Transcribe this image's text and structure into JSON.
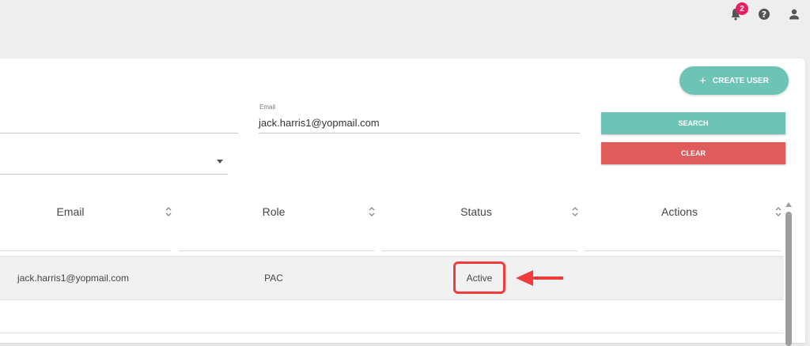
{
  "header": {
    "notification_count": "2",
    "icons": [
      "bell-icon",
      "help-icon",
      "user-icon"
    ]
  },
  "toolbar": {
    "create_user_label": "CREATE USER",
    "create_icon": "+"
  },
  "filters": {
    "email_label": "Email",
    "email_value": "jack.harris1@yopmail.com",
    "search_label": "SEARCH",
    "clear_label": "CLEAR"
  },
  "table": {
    "columns": [
      "Email",
      "Role",
      "Status",
      "Actions"
    ],
    "rows": [
      {
        "email": "jack.harris1@yopmail.com",
        "role": "PAC",
        "status": "Active"
      }
    ]
  },
  "colors": {
    "accent": "#6cc3b6",
    "danger": "#e05b5b",
    "badge": "#e91e63",
    "highlight": "#f03c3c"
  }
}
